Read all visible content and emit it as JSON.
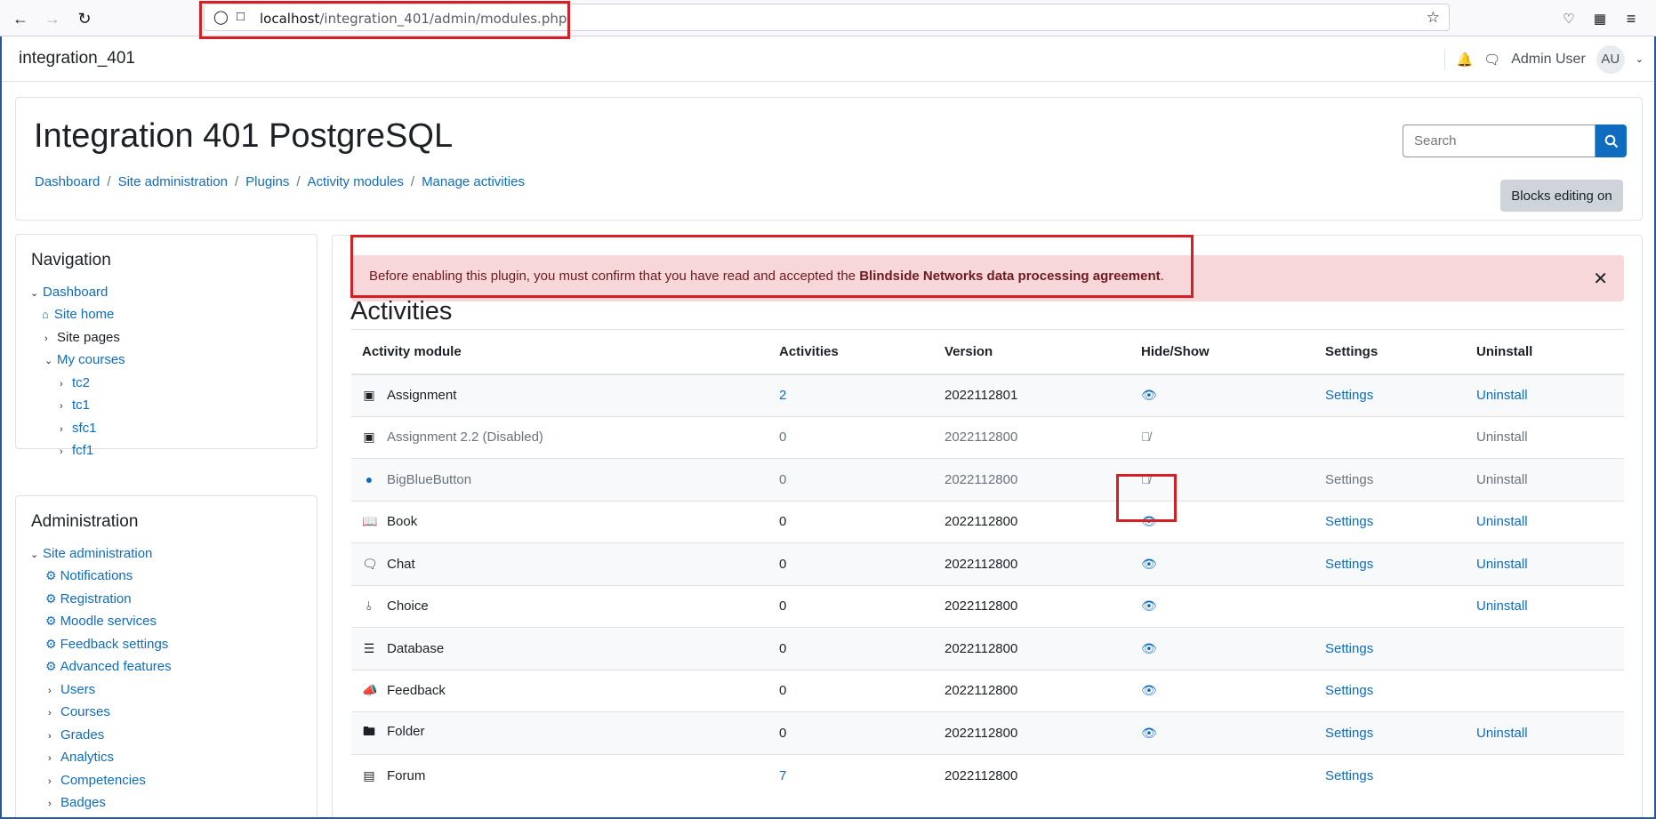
{
  "browser": {
    "url_host": "localhost",
    "url_path": "/integration_401/admin/modules.php"
  },
  "topbar": {
    "site_name": "integration_401",
    "user_name": "Admin User",
    "avatar_initials": "AU"
  },
  "header": {
    "title": "Integration 401 PostgreSQL",
    "breadcrumb": [
      "Dashboard",
      "Site administration",
      "Plugins",
      "Activity modules",
      "Manage activities"
    ],
    "search_placeholder": "Search",
    "blocks_editing_label": "Blocks editing on"
  },
  "navigation": {
    "title": "Navigation",
    "items": [
      {
        "label": "Dashboard"
      },
      {
        "label": "Site home"
      },
      {
        "label": "Site pages"
      },
      {
        "label": "My courses"
      },
      {
        "label": "tc2"
      },
      {
        "label": "tc1"
      },
      {
        "label": "sfc1"
      },
      {
        "label": "fcf1"
      }
    ]
  },
  "administration": {
    "title": "Administration",
    "items": [
      {
        "label": "Site administration"
      },
      {
        "label": "Notifications"
      },
      {
        "label": "Registration"
      },
      {
        "label": "Moodle services"
      },
      {
        "label": "Feedback settings"
      },
      {
        "label": "Advanced features"
      },
      {
        "label": "Users"
      },
      {
        "label": "Courses"
      },
      {
        "label": "Grades"
      },
      {
        "label": "Analytics"
      },
      {
        "label": "Competencies"
      },
      {
        "label": "Badges"
      }
    ]
  },
  "alert": {
    "text": "Before enabling this plugin, you must confirm that you have read and accepted the ",
    "bold": "Blindside Networks data processing agreement",
    "end": "."
  },
  "activities": {
    "title": "Activities",
    "columns": [
      "Activity module",
      "Activities",
      "Version",
      "Hide/Show",
      "Settings",
      "Uninstall"
    ],
    "rows": [
      {
        "name": "Assignment",
        "count": "2",
        "version": "2022112801",
        "settings": "Settings",
        "uninstall": "Uninstall"
      },
      {
        "name": "Assignment 2.2 (Disabled)",
        "count": "0",
        "version": "2022112800",
        "settings": "",
        "uninstall": "Uninstall"
      },
      {
        "name": "BigBlueButton",
        "count": "0",
        "version": "2022112800",
        "settings": "Settings",
        "uninstall": "Uninstall"
      },
      {
        "name": "Book",
        "count": "0",
        "version": "2022112800",
        "settings": "Settings",
        "uninstall": "Uninstall"
      },
      {
        "name": "Chat",
        "count": "0",
        "version": "2022112800",
        "settings": "Settings",
        "uninstall": "Uninstall"
      },
      {
        "name": "Choice",
        "count": "0",
        "version": "2022112800",
        "settings": "",
        "uninstall": "Uninstall"
      },
      {
        "name": "Database",
        "count": "0",
        "version": "2022112800",
        "settings": "Settings",
        "uninstall": ""
      },
      {
        "name": "Feedback",
        "count": "0",
        "version": "2022112800",
        "settings": "Settings",
        "uninstall": ""
      },
      {
        "name": "Folder",
        "count": "0",
        "version": "2022112800",
        "settings": "Settings",
        "uninstall": "Uninstall"
      },
      {
        "name": "Forum",
        "count": "7",
        "version": "2022112800",
        "settings": "Settings",
        "uninstall": ""
      }
    ]
  }
}
